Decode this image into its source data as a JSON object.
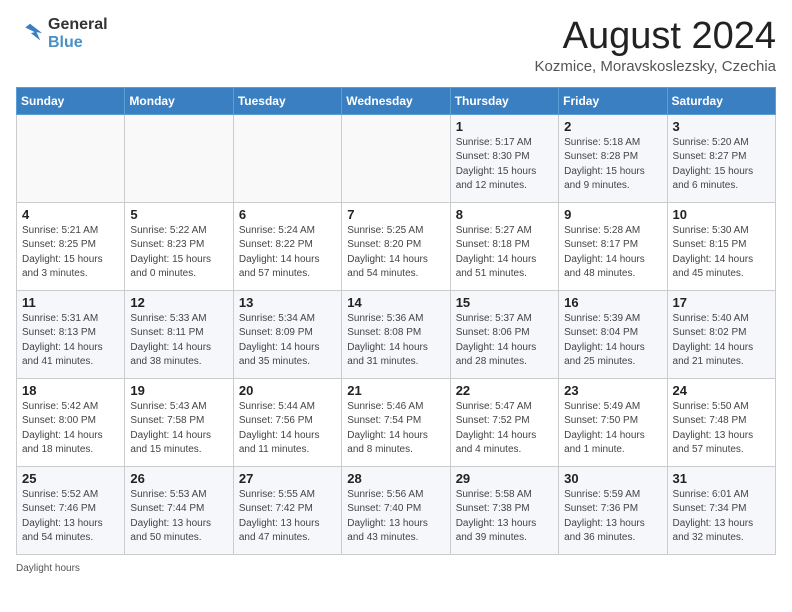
{
  "header": {
    "logo_line1": "General",
    "logo_line2": "Blue",
    "month_title": "August 2024",
    "location": "Kozmice, Moravskoslezsky, Czechia"
  },
  "weekdays": [
    "Sunday",
    "Monday",
    "Tuesday",
    "Wednesday",
    "Thursday",
    "Friday",
    "Saturday"
  ],
  "weeks": [
    [
      {
        "day": "",
        "info": ""
      },
      {
        "day": "",
        "info": ""
      },
      {
        "day": "",
        "info": ""
      },
      {
        "day": "",
        "info": ""
      },
      {
        "day": "1",
        "info": "Sunrise: 5:17 AM\nSunset: 8:30 PM\nDaylight: 15 hours\nand 12 minutes."
      },
      {
        "day": "2",
        "info": "Sunrise: 5:18 AM\nSunset: 8:28 PM\nDaylight: 15 hours\nand 9 minutes."
      },
      {
        "day": "3",
        "info": "Sunrise: 5:20 AM\nSunset: 8:27 PM\nDaylight: 15 hours\nand 6 minutes."
      }
    ],
    [
      {
        "day": "4",
        "info": "Sunrise: 5:21 AM\nSunset: 8:25 PM\nDaylight: 15 hours\nand 3 minutes."
      },
      {
        "day": "5",
        "info": "Sunrise: 5:22 AM\nSunset: 8:23 PM\nDaylight: 15 hours\nand 0 minutes."
      },
      {
        "day": "6",
        "info": "Sunrise: 5:24 AM\nSunset: 8:22 PM\nDaylight: 14 hours\nand 57 minutes."
      },
      {
        "day": "7",
        "info": "Sunrise: 5:25 AM\nSunset: 8:20 PM\nDaylight: 14 hours\nand 54 minutes."
      },
      {
        "day": "8",
        "info": "Sunrise: 5:27 AM\nSunset: 8:18 PM\nDaylight: 14 hours\nand 51 minutes."
      },
      {
        "day": "9",
        "info": "Sunrise: 5:28 AM\nSunset: 8:17 PM\nDaylight: 14 hours\nand 48 minutes."
      },
      {
        "day": "10",
        "info": "Sunrise: 5:30 AM\nSunset: 8:15 PM\nDaylight: 14 hours\nand 45 minutes."
      }
    ],
    [
      {
        "day": "11",
        "info": "Sunrise: 5:31 AM\nSunset: 8:13 PM\nDaylight: 14 hours\nand 41 minutes."
      },
      {
        "day": "12",
        "info": "Sunrise: 5:33 AM\nSunset: 8:11 PM\nDaylight: 14 hours\nand 38 minutes."
      },
      {
        "day": "13",
        "info": "Sunrise: 5:34 AM\nSunset: 8:09 PM\nDaylight: 14 hours\nand 35 minutes."
      },
      {
        "day": "14",
        "info": "Sunrise: 5:36 AM\nSunset: 8:08 PM\nDaylight: 14 hours\nand 31 minutes."
      },
      {
        "day": "15",
        "info": "Sunrise: 5:37 AM\nSunset: 8:06 PM\nDaylight: 14 hours\nand 28 minutes."
      },
      {
        "day": "16",
        "info": "Sunrise: 5:39 AM\nSunset: 8:04 PM\nDaylight: 14 hours\nand 25 minutes."
      },
      {
        "day": "17",
        "info": "Sunrise: 5:40 AM\nSunset: 8:02 PM\nDaylight: 14 hours\nand 21 minutes."
      }
    ],
    [
      {
        "day": "18",
        "info": "Sunrise: 5:42 AM\nSunset: 8:00 PM\nDaylight: 14 hours\nand 18 minutes."
      },
      {
        "day": "19",
        "info": "Sunrise: 5:43 AM\nSunset: 7:58 PM\nDaylight: 14 hours\nand 15 minutes."
      },
      {
        "day": "20",
        "info": "Sunrise: 5:44 AM\nSunset: 7:56 PM\nDaylight: 14 hours\nand 11 minutes."
      },
      {
        "day": "21",
        "info": "Sunrise: 5:46 AM\nSunset: 7:54 PM\nDaylight: 14 hours\nand 8 minutes."
      },
      {
        "day": "22",
        "info": "Sunrise: 5:47 AM\nSunset: 7:52 PM\nDaylight: 14 hours\nand 4 minutes."
      },
      {
        "day": "23",
        "info": "Sunrise: 5:49 AM\nSunset: 7:50 PM\nDaylight: 14 hours\nand 1 minute."
      },
      {
        "day": "24",
        "info": "Sunrise: 5:50 AM\nSunset: 7:48 PM\nDaylight: 13 hours\nand 57 minutes."
      }
    ],
    [
      {
        "day": "25",
        "info": "Sunrise: 5:52 AM\nSunset: 7:46 PM\nDaylight: 13 hours\nand 54 minutes."
      },
      {
        "day": "26",
        "info": "Sunrise: 5:53 AM\nSunset: 7:44 PM\nDaylight: 13 hours\nand 50 minutes."
      },
      {
        "day": "27",
        "info": "Sunrise: 5:55 AM\nSunset: 7:42 PM\nDaylight: 13 hours\nand 47 minutes."
      },
      {
        "day": "28",
        "info": "Sunrise: 5:56 AM\nSunset: 7:40 PM\nDaylight: 13 hours\nand 43 minutes."
      },
      {
        "day": "29",
        "info": "Sunrise: 5:58 AM\nSunset: 7:38 PM\nDaylight: 13 hours\nand 39 minutes."
      },
      {
        "day": "30",
        "info": "Sunrise: 5:59 AM\nSunset: 7:36 PM\nDaylight: 13 hours\nand 36 minutes."
      },
      {
        "day": "31",
        "info": "Sunrise: 6:01 AM\nSunset: 7:34 PM\nDaylight: 13 hours\nand 32 minutes."
      }
    ]
  ],
  "footer": {
    "daylight_note": "Daylight hours"
  }
}
